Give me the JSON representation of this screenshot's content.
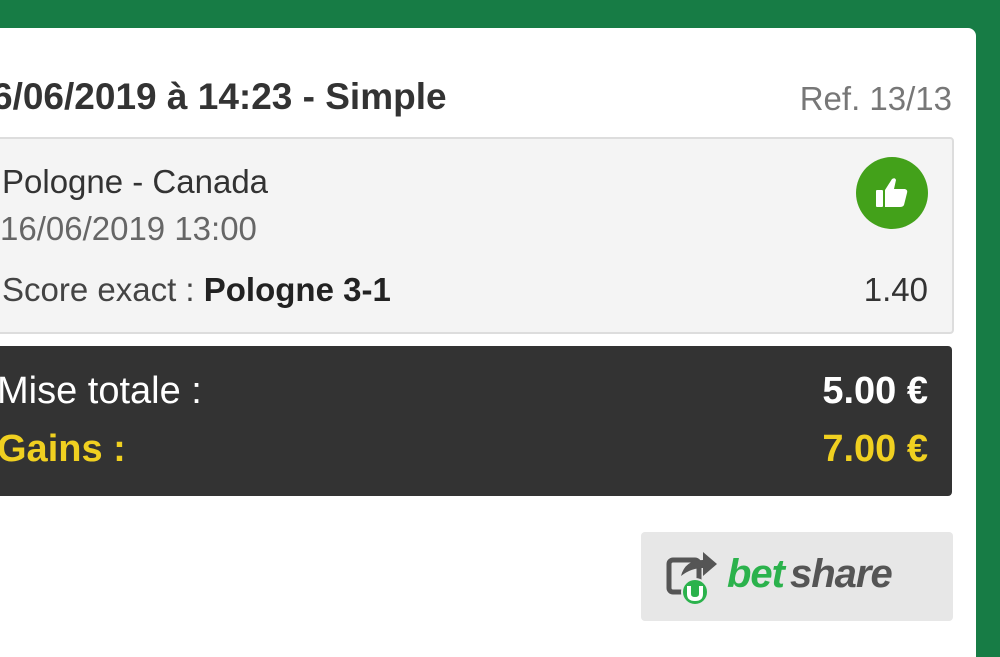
{
  "header": {
    "title": "6/06/2019 à 14:23 - Simple",
    "ref": "Ref. 13/13"
  },
  "bet": {
    "match": "Pologne - Canada",
    "date": "16/06/2019 13:00",
    "selection_label": "Score exact : ",
    "selection_value": "Pologne 3-1",
    "odds": "1.40",
    "status_icon": "thumbs-up-icon"
  },
  "totals": {
    "stake_label": "Mise totale :",
    "stake_value": "5.00 €",
    "gains_label": "Gains :",
    "gains_value": "7.00 €"
  },
  "betshare": {
    "bet_text": "bet",
    "share_text": "share"
  },
  "colors": {
    "background_green": "#177c45",
    "status_green": "#43a11a",
    "totals_dark": "#333333",
    "gains_yellow": "#f0d020",
    "betshare_green": "#2bb24c"
  }
}
